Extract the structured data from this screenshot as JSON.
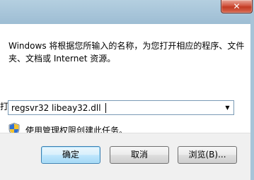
{
  "window": {
    "close_glyph": "✕"
  },
  "dialog": {
    "description": "Windows 将根据您所输入的名称，为您打开相应的程序、文件夹、文档或 Internet 资源。",
    "open_label": "打",
    "input_value": "regsvr32 libeay32.dll",
    "admin_note": "使用管理权限创建此任务。"
  },
  "buttons": {
    "ok": "确定",
    "cancel": "取消",
    "browse": "浏览(B)..."
  },
  "icons": {
    "close": "close-icon",
    "dropdown": "chevron-down-icon",
    "shield": "uac-shield-icon"
  },
  "colors": {
    "default_button_border": "#3c7fb1",
    "close_button": "#c23a22"
  }
}
